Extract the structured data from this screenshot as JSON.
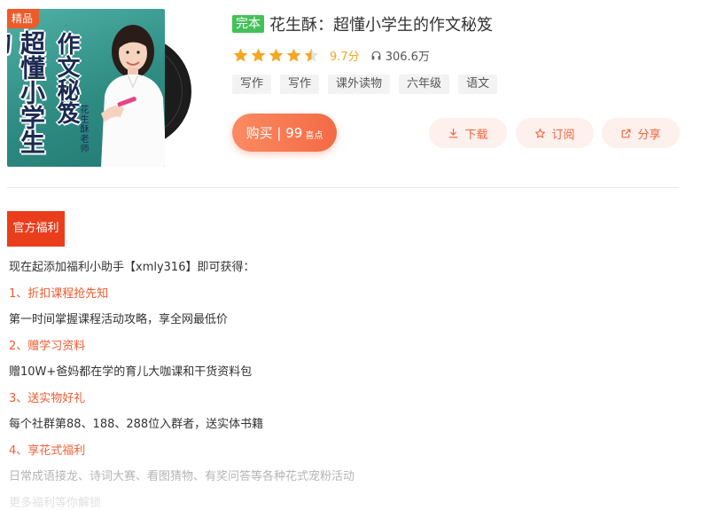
{
  "cover": {
    "badge": "精品",
    "title_left": "超懂小学生的",
    "title_right": "作文秘笈",
    "author_text": "花生酥老师"
  },
  "album": {
    "status_tag": "完本",
    "title": "花生酥：超懂小学生的作文秘笈",
    "rating": 4.5,
    "score_text": "9.7分",
    "play_count": "306.6万",
    "tags": [
      "写作",
      "写作",
      "课外读物",
      "六年级",
      "语文"
    ]
  },
  "actions": {
    "buy_label": "购买 | 99",
    "buy_unit": "喜点",
    "download_label": "下载",
    "subscribe_label": "订阅",
    "share_label": "分享"
  },
  "welfare": {
    "section_label": "官方福利",
    "lines": [
      {
        "text": "现在起添加福利小助手【xmly316】即可获得：",
        "style": "normal"
      },
      {
        "text": "1、折扣课程抢先知",
        "style": "heading"
      },
      {
        "text": "第一时间掌握课程活动攻略，享全网最低价",
        "style": "normal"
      },
      {
        "text": "2、赠学习资料",
        "style": "heading"
      },
      {
        "text": "赠10W+爸妈都在学的育儿大咖课和干货资料包",
        "style": "normal"
      },
      {
        "text": "3、送实物好礼",
        "style": "heading"
      },
      {
        "text": "每个社群第88、188、288位入群者，送实体书籍",
        "style": "normal"
      },
      {
        "text": "4、享花式福利",
        "style": "heading"
      },
      {
        "text": "日常成语接龙、诗词大赛、看图猜物、有奖问答等各种花式宠粉活动",
        "style": "fade1"
      },
      {
        "text": "更多福利等你解锁",
        "style": "fade2"
      }
    ]
  },
  "colors": {
    "accent": "#f46a45",
    "section_red": "#ea3d1c",
    "star": "#f5a623",
    "status_green": "#44c05a"
  },
  "icons": {
    "download": "download-icon",
    "subscribe": "star-outline-icon",
    "share": "external-share-icon",
    "plays": "headphone-icon"
  }
}
